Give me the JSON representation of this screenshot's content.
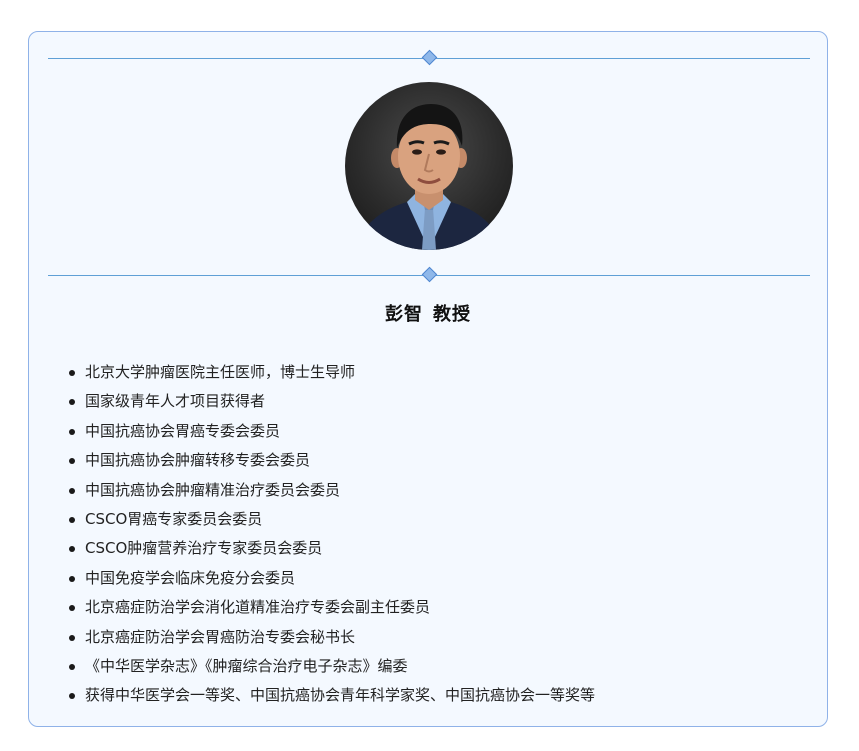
{
  "profile": {
    "name": "彭智",
    "title": "教授",
    "photo_alt": "portrait"
  },
  "bio_items": [
    "北京大学肿瘤医院主任医师，博士生导师",
    "国家级青年人才项目获得者",
    "中国抗癌协会胃癌专委会委员",
    "中国抗癌协会肿瘤转移专委会委员",
    "中国抗癌协会肿瘤精准治疗委员会委员",
    "CSCO胃癌专家委员会委员",
    "CSCO肿瘤营养治疗专家委员会委员",
    "中国免疫学会临床免疫分会委员",
    "北京癌症防治学会消化道精准治疗专委会副主任委员",
    "北京癌症防治学会胃癌防治专委会秘书长",
    "《中华医学杂志》《肿瘤综合治疗电子杂志》编委",
    "获得中华医学会一等奖、中国抗癌协会青年科学家奖、中国抗癌协会一等奖等"
  ],
  "colors": {
    "card_border": "#8fb2e8",
    "card_background": "#f4f9ff",
    "divider_line": "#5fa0d6",
    "divider_diamond": "#8fb8ea"
  }
}
